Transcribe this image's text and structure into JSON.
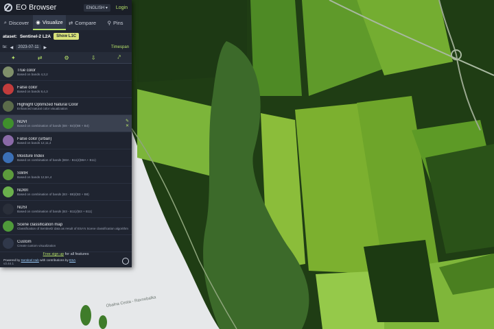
{
  "app": {
    "title": "EO Browser",
    "language": "ENGLISH",
    "login": "Login"
  },
  "tabs": [
    {
      "label": "Discover",
      "icon": "search-icon"
    },
    {
      "label": "Visualize",
      "icon": "eye-icon"
    },
    {
      "label": "Compare",
      "icon": "compare-icon"
    },
    {
      "label": "Pins",
      "icon": "pin-icon"
    }
  ],
  "dataset": {
    "label": "ataset:",
    "value": "Sentinel-2 L2A",
    "button": "Show L1C"
  },
  "date": {
    "prefix": "te:",
    "value": "2023-07-11",
    "timespan": "Timespan"
  },
  "layers": [
    {
      "name": "True color",
      "desc": "Based on bands 4,3,2",
      "color": "#7f8f6a",
      "selected": false
    },
    {
      "name": "False color",
      "desc": "Based on bands 8,4,3",
      "color": "#c23c3c",
      "selected": false
    },
    {
      "name": "Highlight Optimized Natural Color",
      "desc": "Enhanced natural color visualization",
      "color": "#5b6b4a",
      "selected": false
    },
    {
      "name": "NDVI",
      "desc": "Based on combination of bands (B8 - B4)/(B8 + B4)",
      "color": "#3f8f2c",
      "selected": true
    },
    {
      "name": "False color (urban)",
      "desc": "Based on bands 12,11,4",
      "color": "#8a6aa8",
      "selected": false
    },
    {
      "name": "Moisture Index",
      "desc": "Based on combination of bands (B8A - B11)/(B8A + B11)",
      "color": "#3b6fb5",
      "selected": false
    },
    {
      "name": "SWIR",
      "desc": "Based on bands 12,8A,4",
      "color": "#5c9a3c",
      "selected": false
    },
    {
      "name": "NDWI",
      "desc": "Based on combination of bands (B3 - B8)/(B3 + B8)",
      "color": "#6ab04c",
      "selected": false
    },
    {
      "name": "NDSI",
      "desc": "Based on combination of bands (B3 - B11)/(B3 + B11)",
      "color": "#2a2f3a",
      "selected": false
    },
    {
      "name": "Scene classification map",
      "desc": "Classification of Sentinel2 data as result of ESA's Scene classification algorithm",
      "color": "#4f9a3a",
      "selected": false
    },
    {
      "name": "Custom",
      "desc": "Create custom visualization",
      "color": "#30384a",
      "selected": false
    }
  ],
  "footer": {
    "signup_link": "Free sign up",
    "signup_text": " for all features",
    "powered_by": "Powered by ",
    "sh_link": "Sentinel Hub",
    "contrib": " with contributions by ",
    "esa_link": "ESA",
    "version": "v3.44.1"
  },
  "map_labels": {
    "coast": "Obalna Cesta - Ravnobalka"
  },
  "colors": {
    "accent": "#b7e36a",
    "panel_bg": "#1f2430",
    "field_light": "#8fc23c",
    "field_dark": "#244818"
  }
}
